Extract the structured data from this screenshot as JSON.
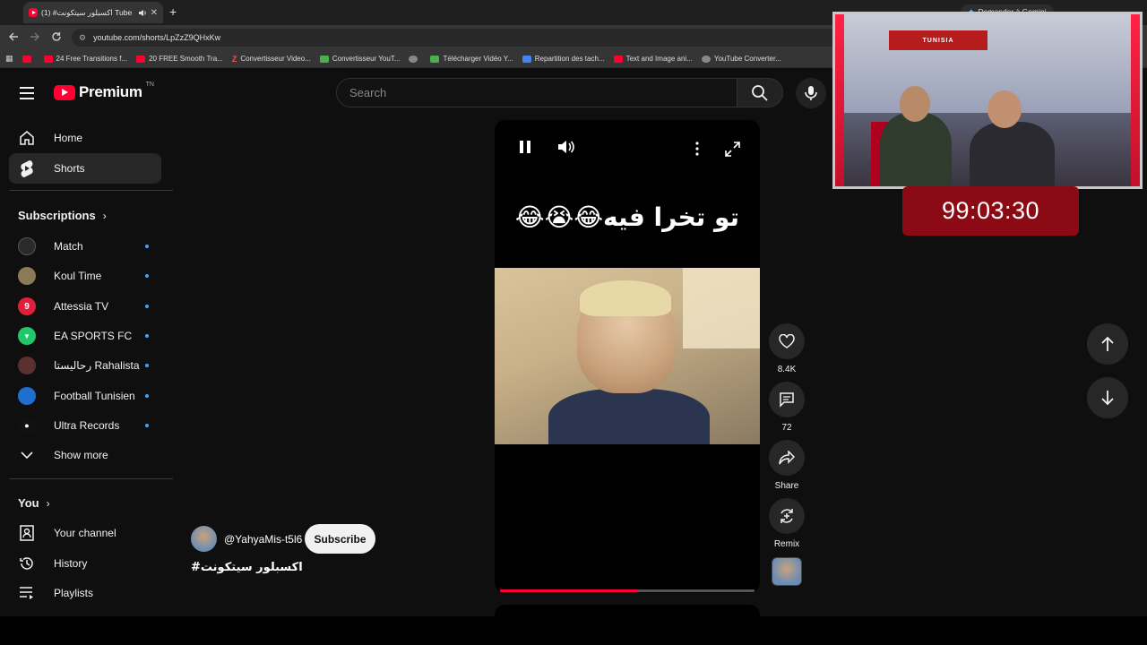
{
  "browser": {
    "tab_title": "اكسبلور سيتكونت# (1) Tube -",
    "tab_close": "✕",
    "new_tab": "+",
    "url": "youtube.com/shorts/LpZzZ9QHxKw",
    "gemini_label": "Demander à Gemini",
    "bookmarks": [
      {
        "label": "",
        "icon": "youtube-icon"
      },
      {
        "label": "24 Free Transitions f...",
        "icon": "youtube-icon"
      },
      {
        "label": "20 FREE Smooth Tra...",
        "icon": "youtube-icon"
      },
      {
        "label": "Convertisseur Video...",
        "icon": "z-icon"
      },
      {
        "label": "Convertisseur YouT...",
        "icon": "convert-icon"
      },
      {
        "label": "",
        "icon": "globe-icon"
      },
      {
        "label": "Télécharger Vidéo Y...",
        "icon": "download-icon"
      },
      {
        "label": "Repartition des tach...",
        "icon": "doc-icon"
      },
      {
        "label": "Text and Image ani...",
        "icon": "youtube-icon"
      },
      {
        "label": "YouTube Converter...",
        "icon": "globe-icon"
      }
    ]
  },
  "header": {
    "logo_text": "Premium",
    "logo_badge": "TN",
    "search_placeholder": "Search"
  },
  "sidebar": {
    "home": "Home",
    "shorts": "Shorts",
    "subscriptions_title": "Subscriptions",
    "subscriptions": [
      {
        "name": "Match",
        "color": "#2a2a2a",
        "glyph": ""
      },
      {
        "name": "Koul Time",
        "color": "#8a7a55",
        "glyph": ""
      },
      {
        "name": "Attessia TV",
        "color": "#e0203a",
        "glyph": "9"
      },
      {
        "name": "EA SPORTS FC",
        "color": "#21c86a",
        "glyph": "▼"
      },
      {
        "name": "رحاليستا Rahalista",
        "color": "#5a3030",
        "glyph": ""
      },
      {
        "name": "Football Tunisien",
        "color": "#1e6fd0",
        "glyph": ""
      },
      {
        "name": "Ultra Records",
        "color": "#111111",
        "glyph": "●"
      }
    ],
    "show_more": "Show more",
    "you_title": "You",
    "your_channel": "Your channel",
    "history": "History",
    "playlists": "Playlists"
  },
  "short": {
    "caption": "تو تخرا فيه😂😭😂",
    "progress": 0.54,
    "channel_handle": "@YahyaMis-t5l6",
    "subscribe_label": "Subscribe",
    "description": "#اكسبلور سيتكونت"
  },
  "actions": {
    "likes": "8.4K",
    "comments": "72",
    "share": "Share",
    "remix": "Remix"
  },
  "overlay": {
    "flag_text": "TUNISIA",
    "timer": "99:03:30"
  }
}
